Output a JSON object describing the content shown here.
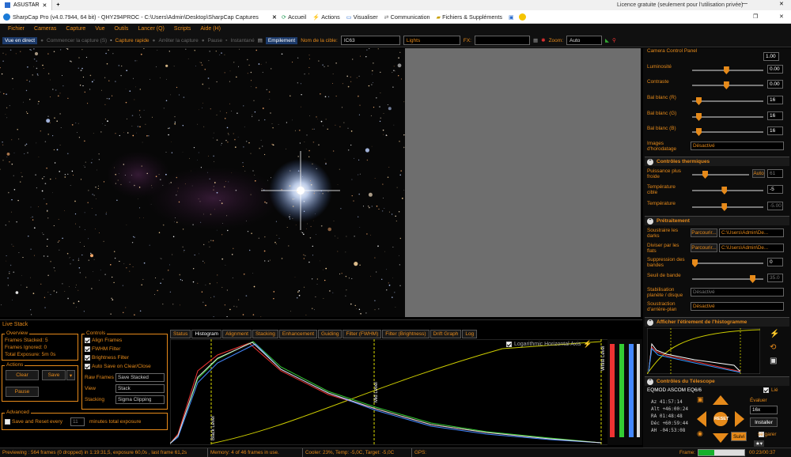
{
  "browser": {
    "tab_label": "ASUSTAR",
    "license": "Licence gratuite (seulement pour l'utilisation privée)"
  },
  "window": {
    "title": "SharpCap Pro (v4.0.7944, 64 bit) - QHY294PROC - C:\\Users\\Admin\\Desktop\\SharpCap Captures",
    "mini_toolbar": [
      "Accueil",
      "Actions",
      "Visualiser",
      "Communication",
      "Fichiers & Suppléments"
    ]
  },
  "menu": [
    "Fichier",
    "Cameras",
    "Capture",
    "Vue",
    "Outils",
    "Lancer (Q)",
    "Scripts",
    "Aide (H)"
  ],
  "toolbar": {
    "live_view": "Vue en direct",
    "start_capture": "Commencer la capture (S)",
    "quick_capture": "Capture rapide",
    "stop_capture": "Arrêter la capture",
    "pause": "Pause",
    "snapshot": "Instantané",
    "stack_label": "Empilement",
    "target_label": "Nom de la cible:",
    "target_value": "IC63",
    "frame_type": "Lights",
    "fx_label": "FX:",
    "zoom_label": "Zoom:",
    "zoom_value": "Auto"
  },
  "right_panel": {
    "camera_title": "Camera Control Panel",
    "gain_value": "1.00",
    "rows": [
      {
        "label": "Luminosité",
        "value": "0.00",
        "level": 0.48
      },
      {
        "label": "Contraste",
        "value": "0.00",
        "level": 0.48
      },
      {
        "label": "Bal blanc (R)",
        "value": "16",
        "level": 0.06
      },
      {
        "label": "Bal blanc (G)",
        "value": "16",
        "level": 0.06
      },
      {
        "label": "Bal blanc (B)",
        "value": "16",
        "level": 0.06
      }
    ],
    "timestamp_label": "Images d'horodatage",
    "timestamp_value": "Désactivé",
    "thermal_title": "Contrôles thermiques",
    "cooler_label": "Puissance plus froide",
    "cooler_auto": "Auto",
    "cooler_value": "61",
    "cooler_level": 0.2,
    "target_temp_label": "Température cible",
    "target_temp_value": "-5",
    "target_temp_level": 0.45,
    "temp_label": "Température",
    "temp_value": "-5.00",
    "temp_level": 0.45,
    "preproc_title": "Prétraitement",
    "darks_label": "Soustraire les darks",
    "darks_browse": "Parcourir...",
    "darks_path": "C:\\Users\\Admin\\De...",
    "flats_label": "Diviser par les flats",
    "flats_browse": "Parcourir...",
    "flats_path": "C:\\Users\\Admin\\De...",
    "banding_label": "Suppression des bandes",
    "banding_value": "0",
    "banding_level": 0.0,
    "band_threshold_label": "Seuil de bande",
    "band_threshold_value": "35.0",
    "band_threshold_level": 0.88,
    "stab_label": "Stabilisation planète / disque",
    "stab_value": "Désactivé",
    "bg_label": "Soustraction d'arrière-plan",
    "bg_value": "Désactivé",
    "histogram_title": "Afficher l'étirement de l'histogramme",
    "telescope_title": "Contrôles du Télescope",
    "telescope_name": "EQMOD ASCOM EQ6/6",
    "linked": "Lié",
    "coords": [
      "Az 41:57:14",
      "Alt +46:00:24",
      "RA 01:48:48",
      "Déc +60:59:44",
      "AH -04:53:08"
    ],
    "rate_label": "Évaluer",
    "rate_value": "16x",
    "install": "Installer",
    "park": "se garer",
    "follow": "Suivi",
    "reset": "RESET"
  },
  "live_stack": {
    "title": "Live Stack",
    "overview_title": "Overview",
    "stats": [
      {
        "label": "Frames Stacked:",
        "value": "5"
      },
      {
        "label": "Frames Ignored:",
        "value": "0"
      },
      {
        "label": "Total Exposure:",
        "value": "5m 0s"
      }
    ],
    "actions_title": "Actions",
    "clear": "Clear",
    "save": "Save",
    "pause": "Pause",
    "controls_title": "Controls",
    "checks": [
      {
        "label": "Align Frames",
        "on": true
      },
      {
        "label": "FWHM Filter",
        "on": true
      },
      {
        "label": "Brightness Filter",
        "on": true
      },
      {
        "label": "Auto Save on Clear/Close",
        "on": true
      }
    ],
    "raw_frames_label": "Raw Frames",
    "raw_frames_value": "Save Stacked",
    "view_label": "View",
    "view_value": "Stack",
    "stacking_label": "Stacking",
    "stacking_value": "Sigma Clipping",
    "advanced_title": "Advanced",
    "save_reset": "Save and Reset every",
    "minutes_value": "11",
    "minutes_label": "minutes total exposure",
    "tabs": [
      "Status",
      "Histogram",
      "Alignment",
      "Stacking",
      "Enhancement",
      "Guiding",
      "Filter (FWHM)",
      "Filter (Brightness)",
      "Drift Graph",
      "Log"
    ],
    "active_tab": "Histogram",
    "log_axis": "Logarithmic Horizontal Axis",
    "black_level": "Black Level",
    "mid_level": "Mid Level",
    "white_level": "White Level"
  },
  "status_bar": {
    "preview": "Previewing : 564 frames (0 dropped) in 1:19:31,5, exposure 60,0s , last frame 61,2s",
    "memory": "Memory: 4 of 46 frames in use.",
    "cooler": "Cooler: 23%, Temp: -5,0C, Target: -5,0C",
    "gps": "GPS:",
    "frame_label": "Frame:",
    "elapsed": "00:23/00:37",
    "frame_progress": 0.35
  }
}
